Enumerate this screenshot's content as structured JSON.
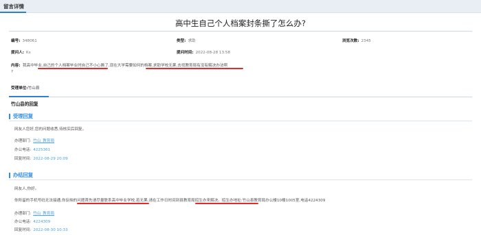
{
  "header": {
    "label": "留言详情"
  },
  "title": "高中生自己个人档案封条撕了怎么办?",
  "meta": {
    "id_label": "编号:",
    "id_value": "348061",
    "type_label": "类型:",
    "type_value": "求助",
    "views_label": "浏览次数:",
    "views_value": "2345",
    "author_label": "提问人:",
    "author_value": "Ks",
    "time_label": "提问时间:",
    "time_value": "2022-08-28 13:58"
  },
  "content": {
    "label": "内容:",
    "text": "我高中毕业,自己的个人档案毕业时自己不小心撕了,现在大学需要如何的档案,求助学校无果,去找教育局有没有解决办法啊",
    "text_tail": "?"
  },
  "unit": {
    "label": "受理单位:",
    "value": "竹山县"
  },
  "reply_title": "竹山县的回复",
  "accept": {
    "heading": "受理回复",
    "body": "网友人您好,您的问题收悉,待核实后回复。",
    "dept_label": "办理部门:",
    "dept_value": "竹山_教育局",
    "phone_label": "办公电话:",
    "phone_value": "4225361",
    "time_label": "回复时间:",
    "time_value": "2022-08-29 20:09"
  },
  "finish": {
    "heading": "办结回复",
    "greeting": "网友人,你好。",
    "body": "你所留的手机号码无法接通,你反映的问题首先请尽量联系高中毕业学校,若无果,请在工作日时间到县教育局招生办来解决。招生办地址:竹山县教育局办公楼10楼1005室,电话4224309",
    "dept_label": "办理部门:",
    "dept_value": "竹山_教育局",
    "phone_label": "办公电话:",
    "phone_value": "4224309",
    "time_label": "回复时间:",
    "time_value": "2022-08-30 10:33"
  },
  "colors": {
    "accent": "#2f8de4",
    "link": "#4aa3df",
    "annotation": "#e52a2a",
    "header_bg": "#e9eef5"
  }
}
